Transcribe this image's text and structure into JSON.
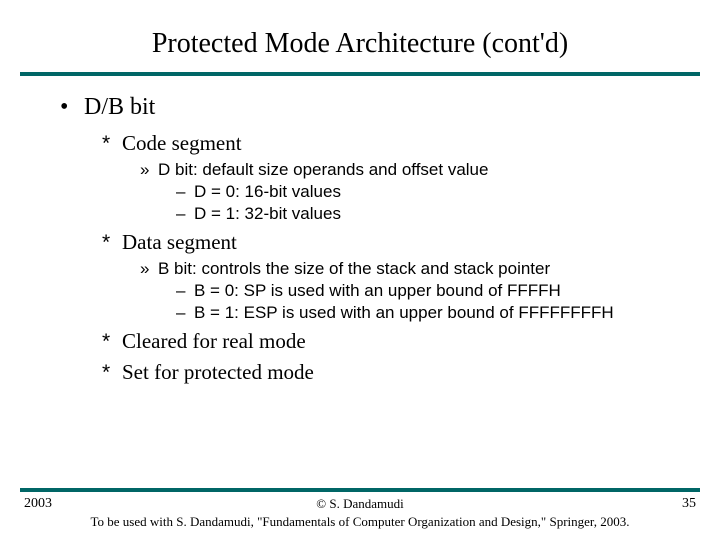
{
  "title": "Protected Mode Architecture (cont'd)",
  "content": {
    "lvl1": {
      "bullet": "•",
      "text": "D/B bit"
    },
    "code_segment": {
      "bullet": "*",
      "text": "Code segment",
      "sub": {
        "bullet": "»",
        "text": "D bit: default size operands and offset value",
        "items": [
          {
            "bullet": "–",
            "text": "D = 0: 16-bit values"
          },
          {
            "bullet": "–",
            "text": "D = 1: 32-bit values"
          }
        ]
      }
    },
    "data_segment": {
      "bullet": "*",
      "text": "Data segment",
      "sub": {
        "bullet": "»",
        "text": "B bit: controls the size of the stack and stack pointer",
        "items": [
          {
            "bullet": "–",
            "text": "B = 0: SP is used with an upper bound of FFFFH"
          },
          {
            "bullet": "–",
            "text": "B = 1: ESP is used with an upper bound of FFFFFFFFH"
          }
        ]
      }
    },
    "cleared": {
      "bullet": "*",
      "text": "Cleared for real mode"
    },
    "set": {
      "bullet": "*",
      "text": "Set for protected mode"
    }
  },
  "footer": {
    "year": "2003",
    "copyright": "© S. Dandamudi",
    "citation": "To be used with S. Dandamudi, \"Fundamentals of Computer Organization and Design,\" Springer, 2003.",
    "page": "35"
  }
}
